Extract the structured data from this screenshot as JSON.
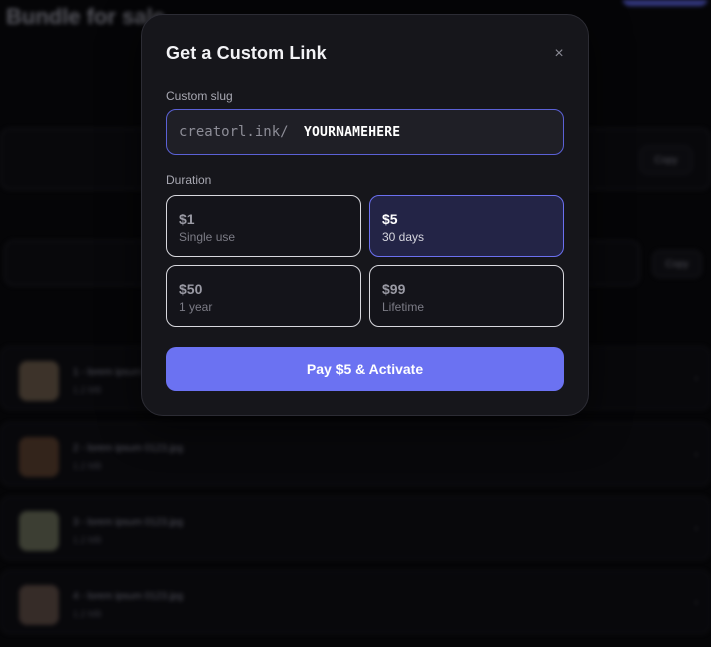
{
  "background": {
    "title": "Bundle for sale",
    "rows": [
      {
        "title": "1 - lorem ipsum 0123.jpg",
        "meta": "1.2 MB",
        "thumb_color": "#6b5a48"
      },
      {
        "title": "2 - lorem ipsum 0123.jpg",
        "meta": "1.2 MB",
        "thumb_color": "#5a3e2c"
      },
      {
        "title": "3 - lorem ipsum 0123.jpg",
        "meta": "1.2 MB",
        "thumb_color": "#6a6e58"
      },
      {
        "title": "4 - lorem ipsum 0123.jpg",
        "meta": "1.2 MB",
        "thumb_color": "#5e4c44"
      }
    ],
    "copy_label": "Copy"
  },
  "modal": {
    "title": "Get a Custom Link",
    "close_icon": "×",
    "slug_label": "Custom slug",
    "slug_prefix": "creatorl.ink/",
    "slug_value": "YOURNAMEHERE",
    "duration_label": "Duration",
    "options": [
      {
        "price": "$1",
        "desc": "Single use",
        "selected": false
      },
      {
        "price": "$5",
        "desc": "30 days",
        "selected": true
      },
      {
        "price": "$50",
        "desc": "1 year",
        "selected": false
      },
      {
        "price": "$99",
        "desc": "Lifetime",
        "selected": false
      }
    ],
    "pay_button": "Pay $5 & Activate"
  },
  "colors": {
    "accent": "#6b72f2",
    "selected_bg": "#232446",
    "modal_bg": "#16161b"
  }
}
